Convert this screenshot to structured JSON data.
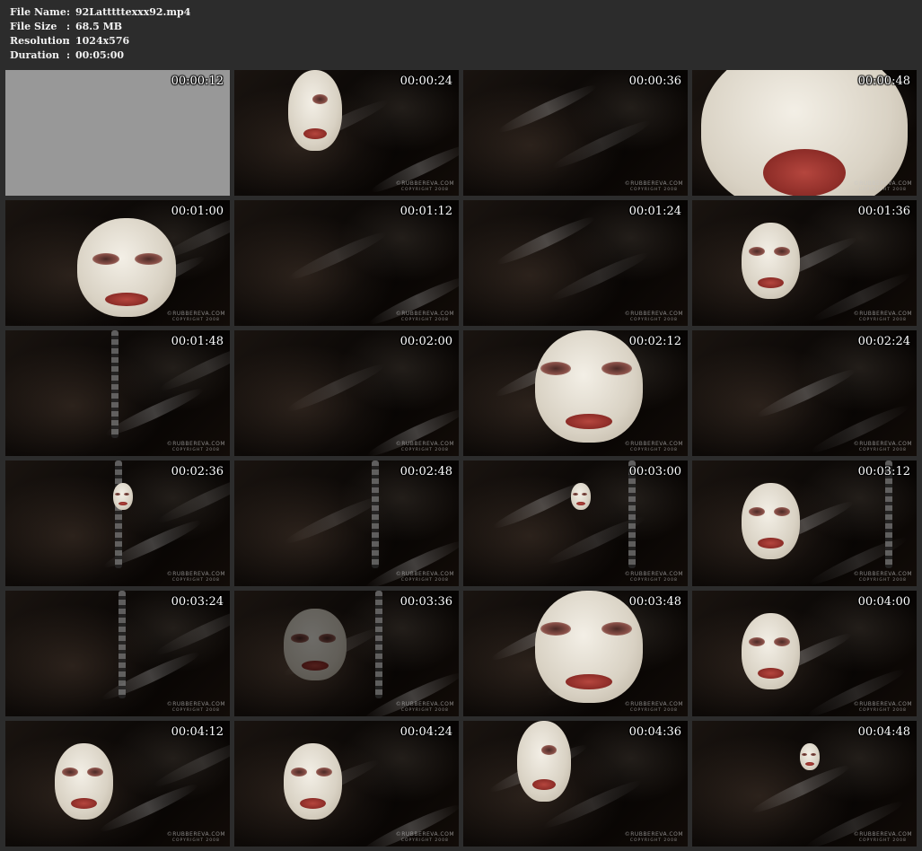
{
  "file_info": [
    {
      "label": "File Name",
      "sep": ":",
      "value": "92Latttttexxx92.mp4"
    },
    {
      "label": "File Size",
      "sep": ":",
      "value": "68.5 MB"
    },
    {
      "label": "Resolution",
      "sep": ":",
      "value": "1024x576"
    },
    {
      "label": "Duration",
      "sep": ":",
      "value": "00:05:00"
    }
  ],
  "watermark": {
    "site": "RUBBEREVA.COM",
    "sub": "COPYRIGHT 2008"
  },
  "thumbnails": [
    {
      "time": "00:00:12",
      "blank": true
    },
    {
      "time": "00:00:24",
      "face": "side"
    },
    {
      "time": "00:00:36"
    },
    {
      "time": "00:00:48",
      "face": "close"
    },
    {
      "time": "00:01:00",
      "face": "clear"
    },
    {
      "time": "00:01:12"
    },
    {
      "time": "00:01:24"
    },
    {
      "time": "00:01:36",
      "face": "hood"
    },
    {
      "time": "00:01:48",
      "chain": true
    },
    {
      "time": "00:02:00"
    },
    {
      "time": "00:02:12",
      "face": "big"
    },
    {
      "time": "00:02:24"
    },
    {
      "time": "00:02:36",
      "face": "tiny",
      "chain": true
    },
    {
      "time": "00:02:48",
      "chain": true
    },
    {
      "time": "00:03:00",
      "face": "tiny",
      "chain": true
    },
    {
      "time": "00:03:12",
      "face": "hood",
      "chain": true
    },
    {
      "time": "00:03:24",
      "chain": true
    },
    {
      "time": "00:03:36",
      "face": "dark",
      "chain": true
    },
    {
      "time": "00:03:48",
      "face": "big"
    },
    {
      "time": "00:04:00",
      "face": "hood"
    },
    {
      "time": "00:04:12",
      "face": "hood"
    },
    {
      "time": "00:04:24",
      "face": "hood"
    },
    {
      "time": "00:04:36",
      "face": "side"
    },
    {
      "time": "00:04:48",
      "face": "tiny"
    }
  ]
}
